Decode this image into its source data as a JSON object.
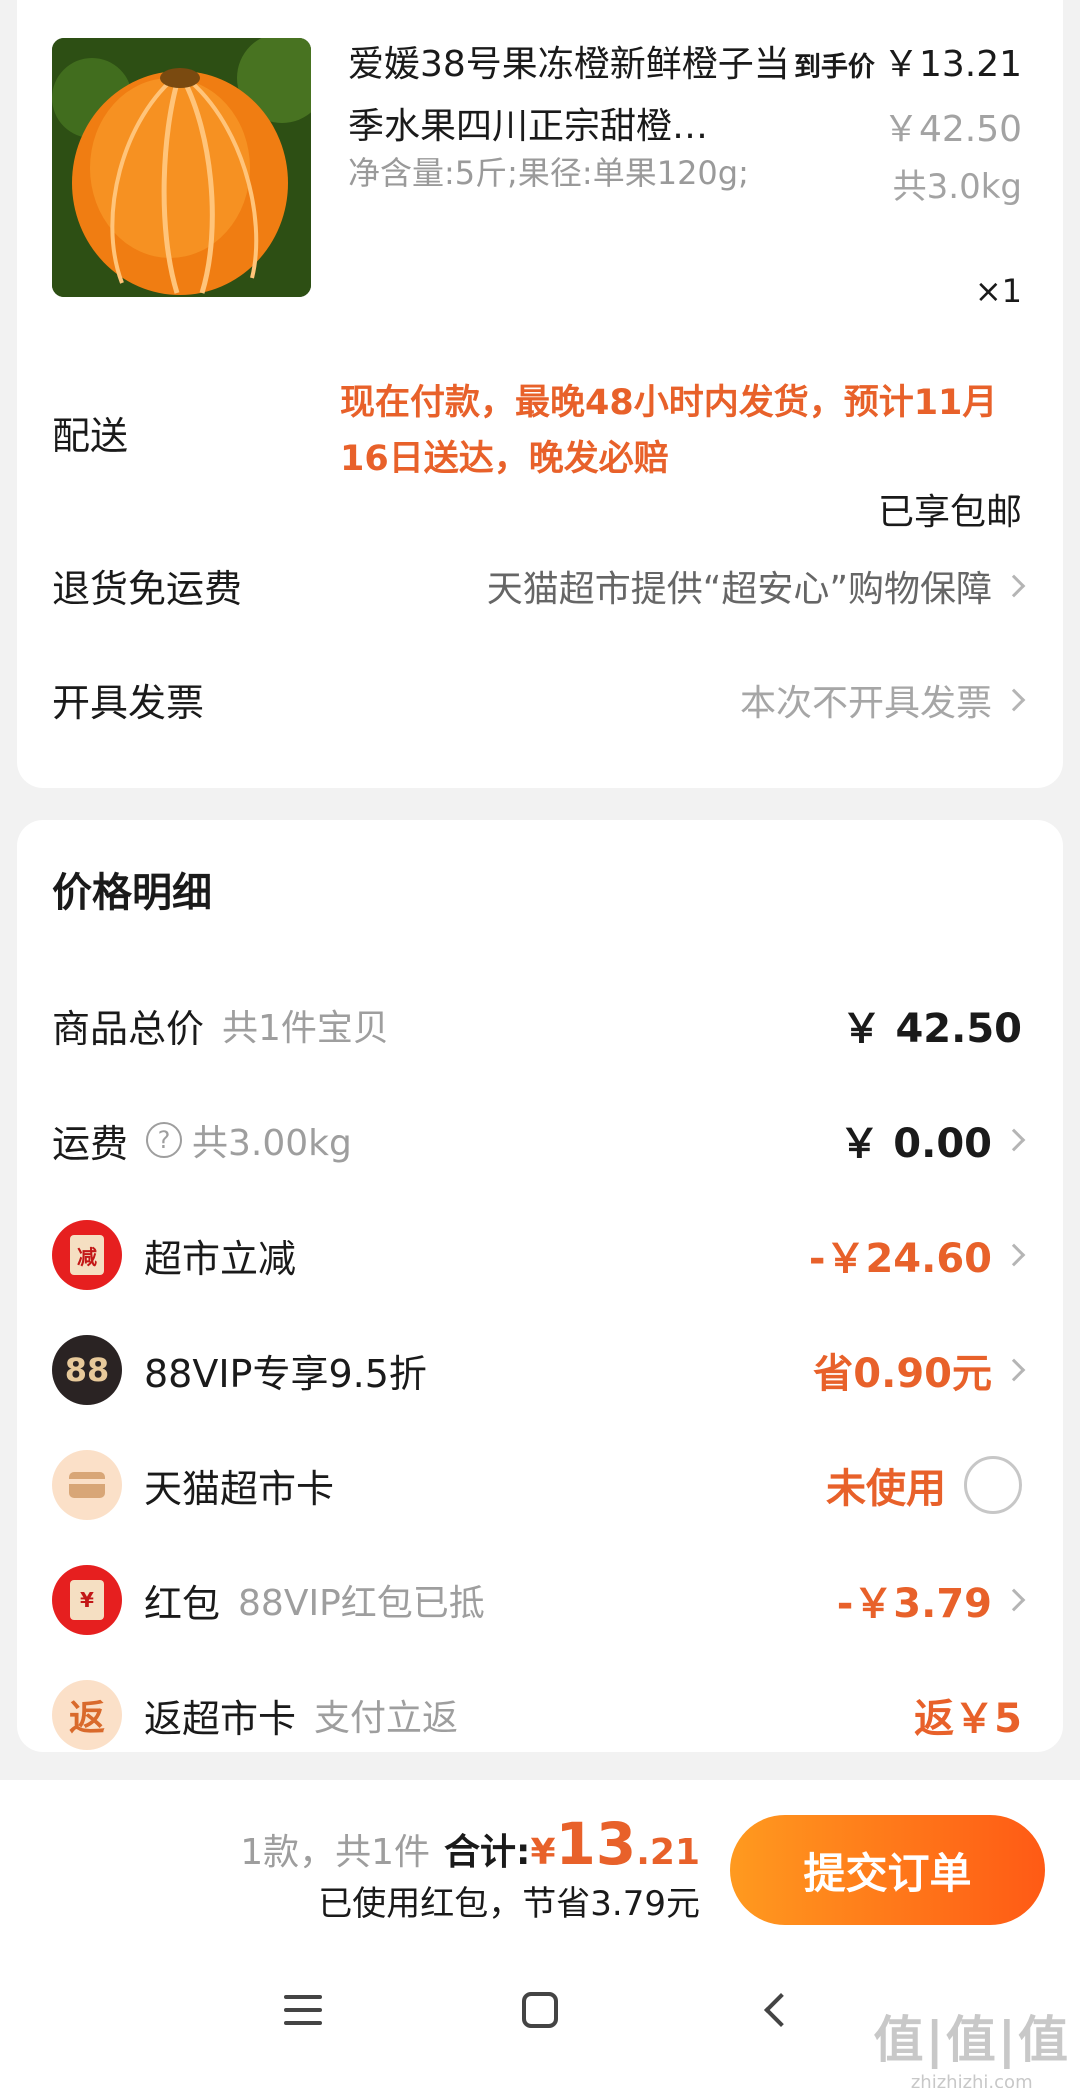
{
  "product": {
    "title": "爱媛38号果冻橙新鲜橙子当季水果四川正宗甜橙…",
    "spec": "净含量:5斤;果径:单果120g;",
    "final_price_tag": "到手价",
    "final_price": "￥13.21",
    "original_price": "￥42.50",
    "weight": "共3.0kg",
    "quantity": "×1"
  },
  "delivery": {
    "label": "配送",
    "note": "现在付款，最晚48小时内发货，预计11月16日送达，晚发必赔",
    "free_shipping": "已享包邮"
  },
  "return_shipping": {
    "label": "退货免运费",
    "value": "天猫超市提供“超安心”购物保障"
  },
  "invoice": {
    "label": "开具发票",
    "value": "本次不开具发票"
  },
  "price_detail": {
    "title": "价格明细",
    "goods_total": {
      "label": "商品总价",
      "sub": "共1件宝贝",
      "amount": "￥ 42.50"
    },
    "shipping": {
      "label": "运费",
      "help": "?",
      "sub": "共3.00kg",
      "amount": "￥ 0.00"
    },
    "market_discount": {
      "label": "超市立减",
      "icon_text": "减",
      "amount": "-￥24.60"
    },
    "vip": {
      "label": "88VIP专享9.5折",
      "icon_text": "88",
      "amount": "省0.90元"
    },
    "market_card": {
      "label": "天猫超市卡",
      "status": "未使用"
    },
    "red_packet": {
      "label": "红包",
      "icon_text": "¥",
      "sub": "88VIP红包已抵",
      "amount": "-￥3.79"
    },
    "cashback": {
      "label": "返超市卡",
      "icon_text": "返",
      "sub": "支付立返",
      "amount": "返￥5"
    }
  },
  "footer": {
    "count": "1款，共1件",
    "total_label": "合计:",
    "currency": "¥",
    "total_int": "13",
    "total_dec": ".21",
    "saved": "已使用红包，节省3.79元",
    "submit": "提交订单"
  },
  "watermark": {
    "big": "值|值|值",
    "small": "zhizhizhi.com"
  },
  "colors": {
    "accent": "#e8612a",
    "button_start": "#ff9a1f",
    "button_end": "#ff5a15"
  }
}
